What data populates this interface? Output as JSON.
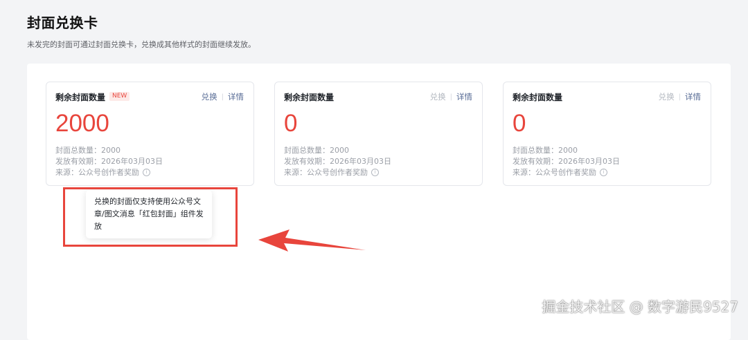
{
  "page": {
    "title": "封面兑换卡",
    "description": "未发完的封面可通过封面兑换卡，兑换成其他样式的封面继续发放。"
  },
  "cards": [
    {
      "title": "剩余封面数量",
      "badge": "NEW",
      "count": "2000",
      "exchange_label": "兑换",
      "separator": "|",
      "detail_label": "详情",
      "total_line": "封面总数量：2000",
      "valid_line": "发放有效期：2026年03月03日",
      "source_line": "来源：公众号创作者奖励",
      "info_icon": "i",
      "exchange_enabled": true
    },
    {
      "title": "剩余封面数量",
      "count": "0",
      "exchange_label": "兑换",
      "separator": "|",
      "detail_label": "详情",
      "total_line": "封面总数量：2000",
      "valid_line": "发放有效期：2026年03月03日",
      "source_line": "来源：公众号创作者奖励",
      "info_icon": "i",
      "exchange_enabled": false
    },
    {
      "title": "剩余封面数量",
      "count": "0",
      "exchange_label": "兑换",
      "separator": "|",
      "detail_label": "详情",
      "total_line": "封面总数量：2000",
      "valid_line": "发放有效期：2026年03月03日",
      "source_line": "来源：公众号创作者奖励",
      "info_icon": "i",
      "exchange_enabled": false
    }
  ],
  "tooltip": {
    "text": "兑换的封面仅支持使用公众号文章/图文消息「红包封面」组件发放"
  },
  "watermark": "掘金技术社区 @ 数字游民9527",
  "colors": {
    "accent_red": "#e8453c",
    "link_blue": "#576b95",
    "disabled_gray": "#b2b7bf",
    "page_bg": "#f3f4f6"
  }
}
